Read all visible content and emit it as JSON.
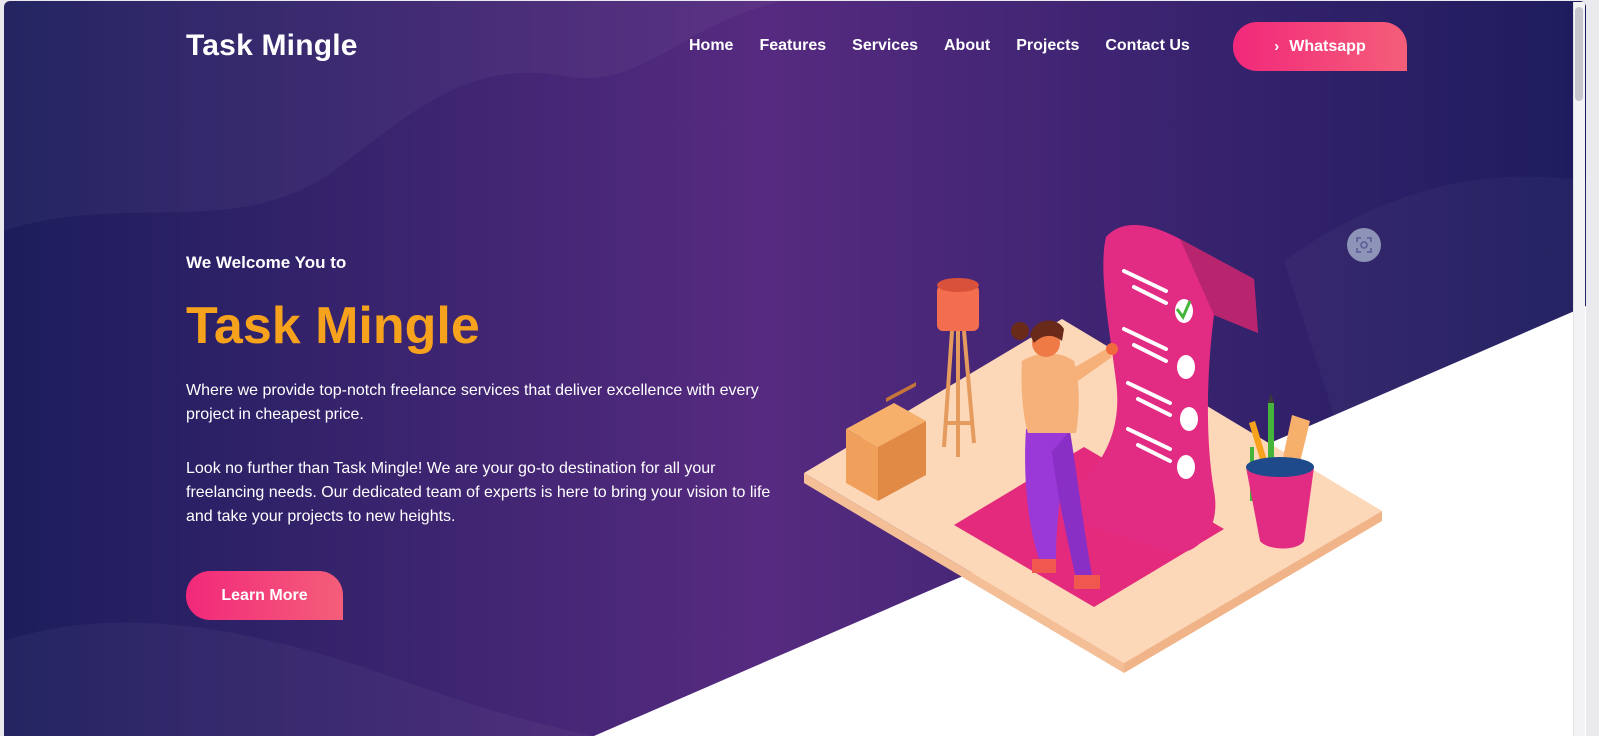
{
  "brand": {
    "logo": "Task Mingle"
  },
  "nav": {
    "items": [
      {
        "label": "Home"
      },
      {
        "label": "Features"
      },
      {
        "label": "Services"
      },
      {
        "label": "About"
      },
      {
        "label": "Projects"
      },
      {
        "label": "Contact Us"
      }
    ],
    "whatsapp_label": "Whatsapp",
    "whatsapp_icon": "chevron-right-icon"
  },
  "hero": {
    "welcome": "We Welcome You to",
    "title": "Task Mingle",
    "paragraph_1": "Where we provide top-notch freelance services that deliver excellence with every project in cheapest price.",
    "paragraph_2": "Look no further than Task Mingle! We are your go-to destination for all your freelancing needs. Our dedicated team of experts is here to bring your vision to life and take your projects to new heights.",
    "cta_label": "Learn More",
    "scan_icon": "scan-icon"
  },
  "colors": {
    "hero_dark": "#1e1b5e",
    "hero_purple": "#5a2a83",
    "accent_orange": "#f6a21c",
    "accent_pink": "#f2287a"
  }
}
